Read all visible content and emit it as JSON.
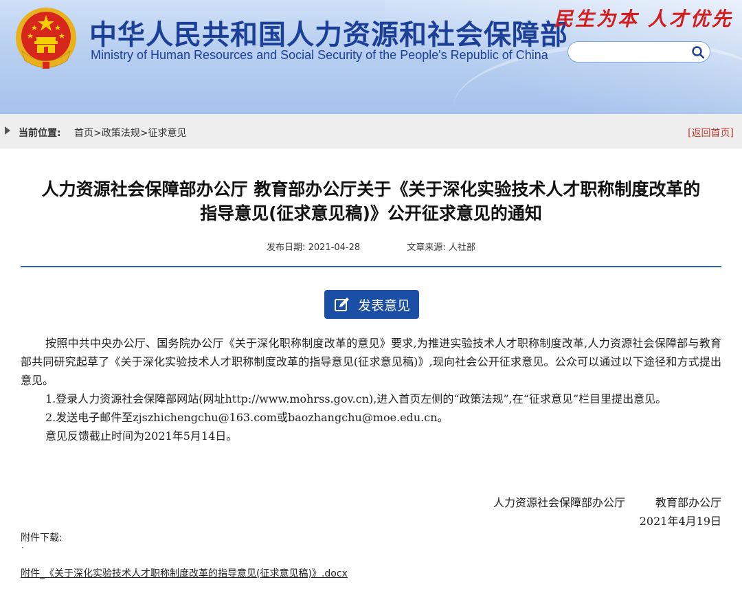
{
  "header": {
    "title_cn": "中华人民共和国人力资源和社会保障部",
    "title_en": "Ministry of Human Resources and Social Security of the People's Republic of China",
    "slogan": "民生为本 人才优先",
    "search_placeholder": "",
    "emblem_icon": "national-emblem-icon",
    "search_icon": "search-icon"
  },
  "breadcrumb": {
    "label": "当前位置:",
    "items": [
      "首页",
      "政策法规",
      "征求意见"
    ],
    "separator": ">",
    "return_home": "[返回首页]"
  },
  "article": {
    "title_line1": "人力资源社会保障部办公厅 教育部办公厅关于《关于深化实验技术人才职称制度改革的",
    "title_line2": "指导意见(征求意见稿)》公开征求意见的通知",
    "date_label": "发布日期:",
    "date": "2021-04-28",
    "source_label": "文章来源:",
    "source": "人社部",
    "comment_button": "发表意见",
    "paragraphs": [
      "按照中共中央办公厅、国务院办公厅《关于深化职称制度改革的意见》要求,为推进实验技术人才职称制度改革,人力资源社会保障部与教育部共同研究起草了《关于深化实验技术人才职称制度改革的指导意见(征求意见稿)》,现向社会公开征求意见。公众可以通过以下途径和方式提出意见。",
      "1.登录人力资源社会保障部网站(网址http://www.mohrss.gov.cn),进入首页左侧的“政策法规”,在“征求意见”栏目里提出意见。",
      "2.发送电子邮件至zjszhichengchu@163.com或baozhangchu@moe.edu.cn。",
      "意见反馈截止时间为2021年5月14日。"
    ],
    "sign_org1": "人力资源社会保障部办公厅",
    "sign_org2": "教育部办公厅",
    "sign_date": "2021年4月19日",
    "attachment_label": "附件下载:",
    "attachment_bullet": "·",
    "attachment_link": "附件_《关于深化实验技术人才职称制度改革的指导意见(征求意见稿)》.docx"
  },
  "colors": {
    "brand_blue": "#1c3f97",
    "button_blue": "#1b4fa5",
    "slogan_red": "#d21e1e",
    "return_red": "#c0392b",
    "divider_blue": "#2d61b4"
  }
}
